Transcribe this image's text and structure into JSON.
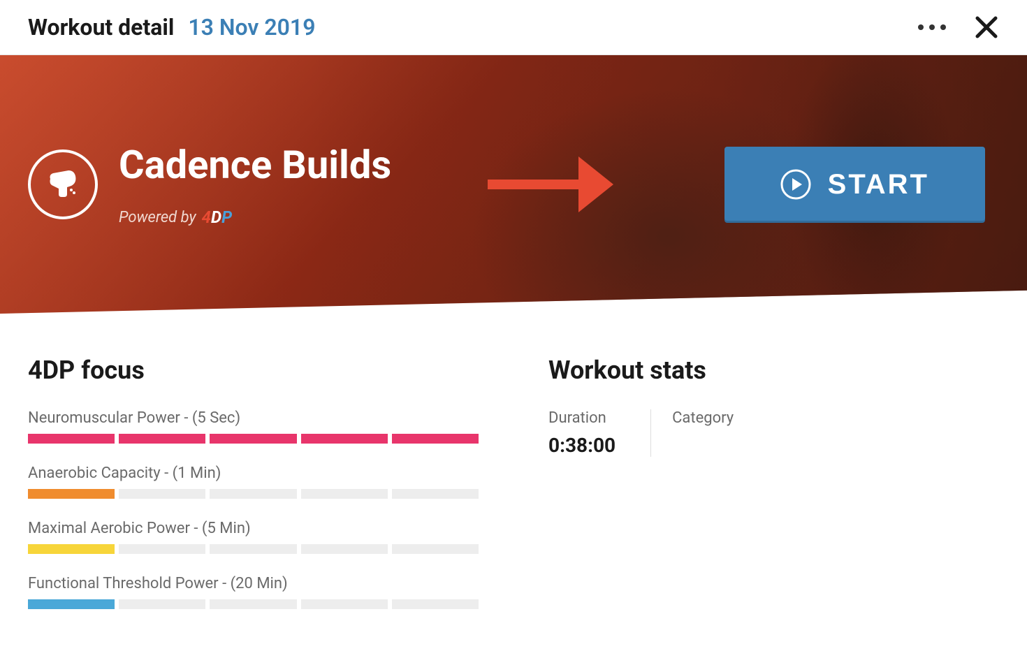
{
  "header": {
    "title": "Workout detail",
    "date": "13 Nov 2019"
  },
  "hero": {
    "title": "Cadence Builds",
    "powered_by": "Powered by",
    "brand": "4DP",
    "start_label": "START"
  },
  "focus": {
    "section_title": "4DP focus",
    "items": [
      {
        "label": "Neuromuscular Power - (5 Sec)",
        "level": 5,
        "color": "pink"
      },
      {
        "label": "Anaerobic Capacity - (1 Min)",
        "level": 1,
        "color": "orange"
      },
      {
        "label": "Maximal Aerobic Power - (5 Min)",
        "level": 1,
        "color": "yellow"
      },
      {
        "label": "Functional Threshold Power - (20 Min)",
        "level": 1,
        "color": "blue"
      }
    ]
  },
  "stats": {
    "section_title": "Workout stats",
    "duration_label": "Duration",
    "duration_value": "0:38:00",
    "category_label": "Category"
  }
}
